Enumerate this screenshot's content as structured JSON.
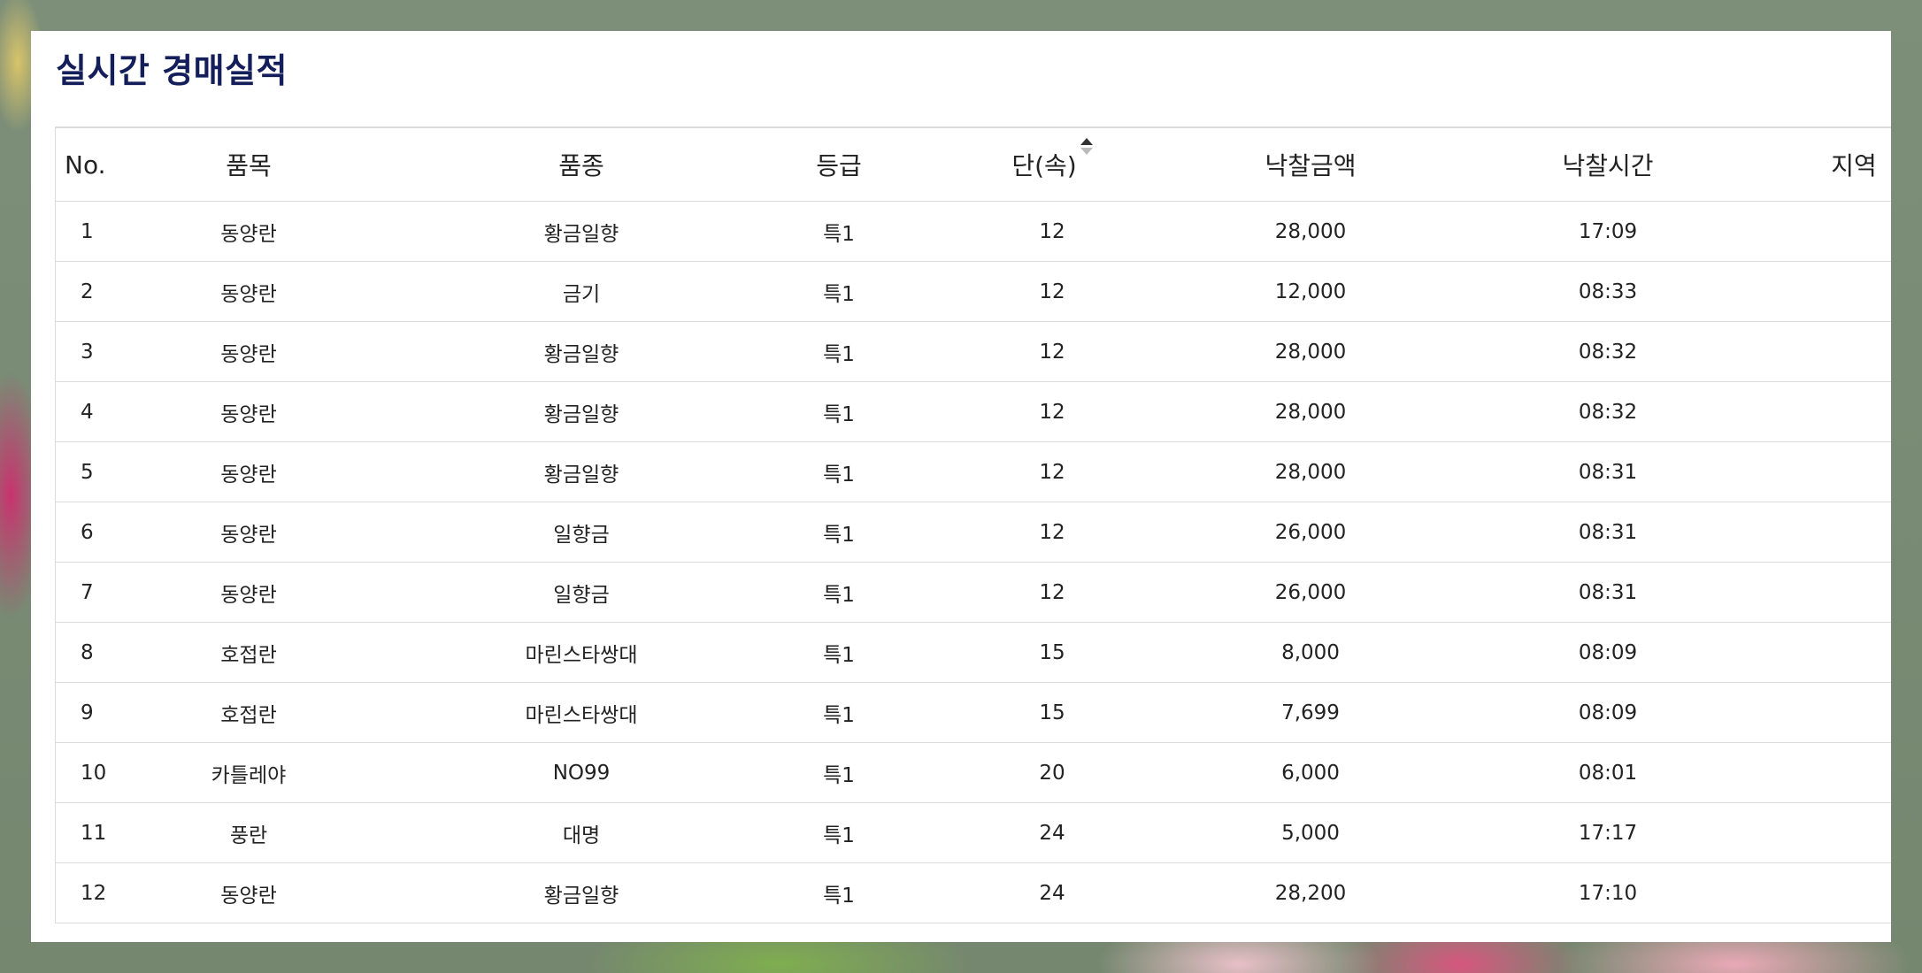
{
  "page": {
    "title": "실시간 경매실적"
  },
  "table": {
    "headers": {
      "no": "No.",
      "item": "품목",
      "variety": "품종",
      "grade": "등급",
      "unit": "단(속)",
      "amount": "낙찰금액",
      "time": "낙찰시간",
      "region": "지역"
    },
    "rows": [
      {
        "no": "1",
        "item": "동양란",
        "variety": "황금일향",
        "grade": "특1",
        "unit": "12",
        "amount": "28,000",
        "time": "17:09",
        "region": ""
      },
      {
        "no": "2",
        "item": "동양란",
        "variety": "금기",
        "grade": "특1",
        "unit": "12",
        "amount": "12,000",
        "time": "08:33",
        "region": ""
      },
      {
        "no": "3",
        "item": "동양란",
        "variety": "황금일향",
        "grade": "특1",
        "unit": "12",
        "amount": "28,000",
        "time": "08:32",
        "region": ""
      },
      {
        "no": "4",
        "item": "동양란",
        "variety": "황금일향",
        "grade": "특1",
        "unit": "12",
        "amount": "28,000",
        "time": "08:32",
        "region": ""
      },
      {
        "no": "5",
        "item": "동양란",
        "variety": "황금일향",
        "grade": "특1",
        "unit": "12",
        "amount": "28,000",
        "time": "08:31",
        "region": ""
      },
      {
        "no": "6",
        "item": "동양란",
        "variety": "일향금",
        "grade": "특1",
        "unit": "12",
        "amount": "26,000",
        "time": "08:31",
        "region": ""
      },
      {
        "no": "7",
        "item": "동양란",
        "variety": "일향금",
        "grade": "특1",
        "unit": "12",
        "amount": "26,000",
        "time": "08:31",
        "region": ""
      },
      {
        "no": "8",
        "item": "호접란",
        "variety": "마린스타쌍대",
        "grade": "특1",
        "unit": "15",
        "amount": "8,000",
        "time": "08:09",
        "region": ""
      },
      {
        "no": "9",
        "item": "호접란",
        "variety": "마린스타쌍대",
        "grade": "특1",
        "unit": "15",
        "amount": "7,699",
        "time": "08:09",
        "region": ""
      },
      {
        "no": "10",
        "item": "카틀레야",
        "variety": "NO99",
        "grade": "특1",
        "unit": "20",
        "amount": "6,000",
        "time": "08:01",
        "region": ""
      },
      {
        "no": "11",
        "item": "풍란",
        "variety": "대명",
        "grade": "특1",
        "unit": "24",
        "amount": "5,000",
        "time": "17:17",
        "region": ""
      },
      {
        "no": "12",
        "item": "동양란",
        "variety": "황금일향",
        "grade": "특1",
        "unit": "24",
        "amount": "28,200",
        "time": "17:10",
        "region": ""
      }
    ]
  },
  "icons": {
    "sort": "sort-icon"
  },
  "colors": {
    "title": "#141e5a",
    "background": "#7c8c77"
  }
}
